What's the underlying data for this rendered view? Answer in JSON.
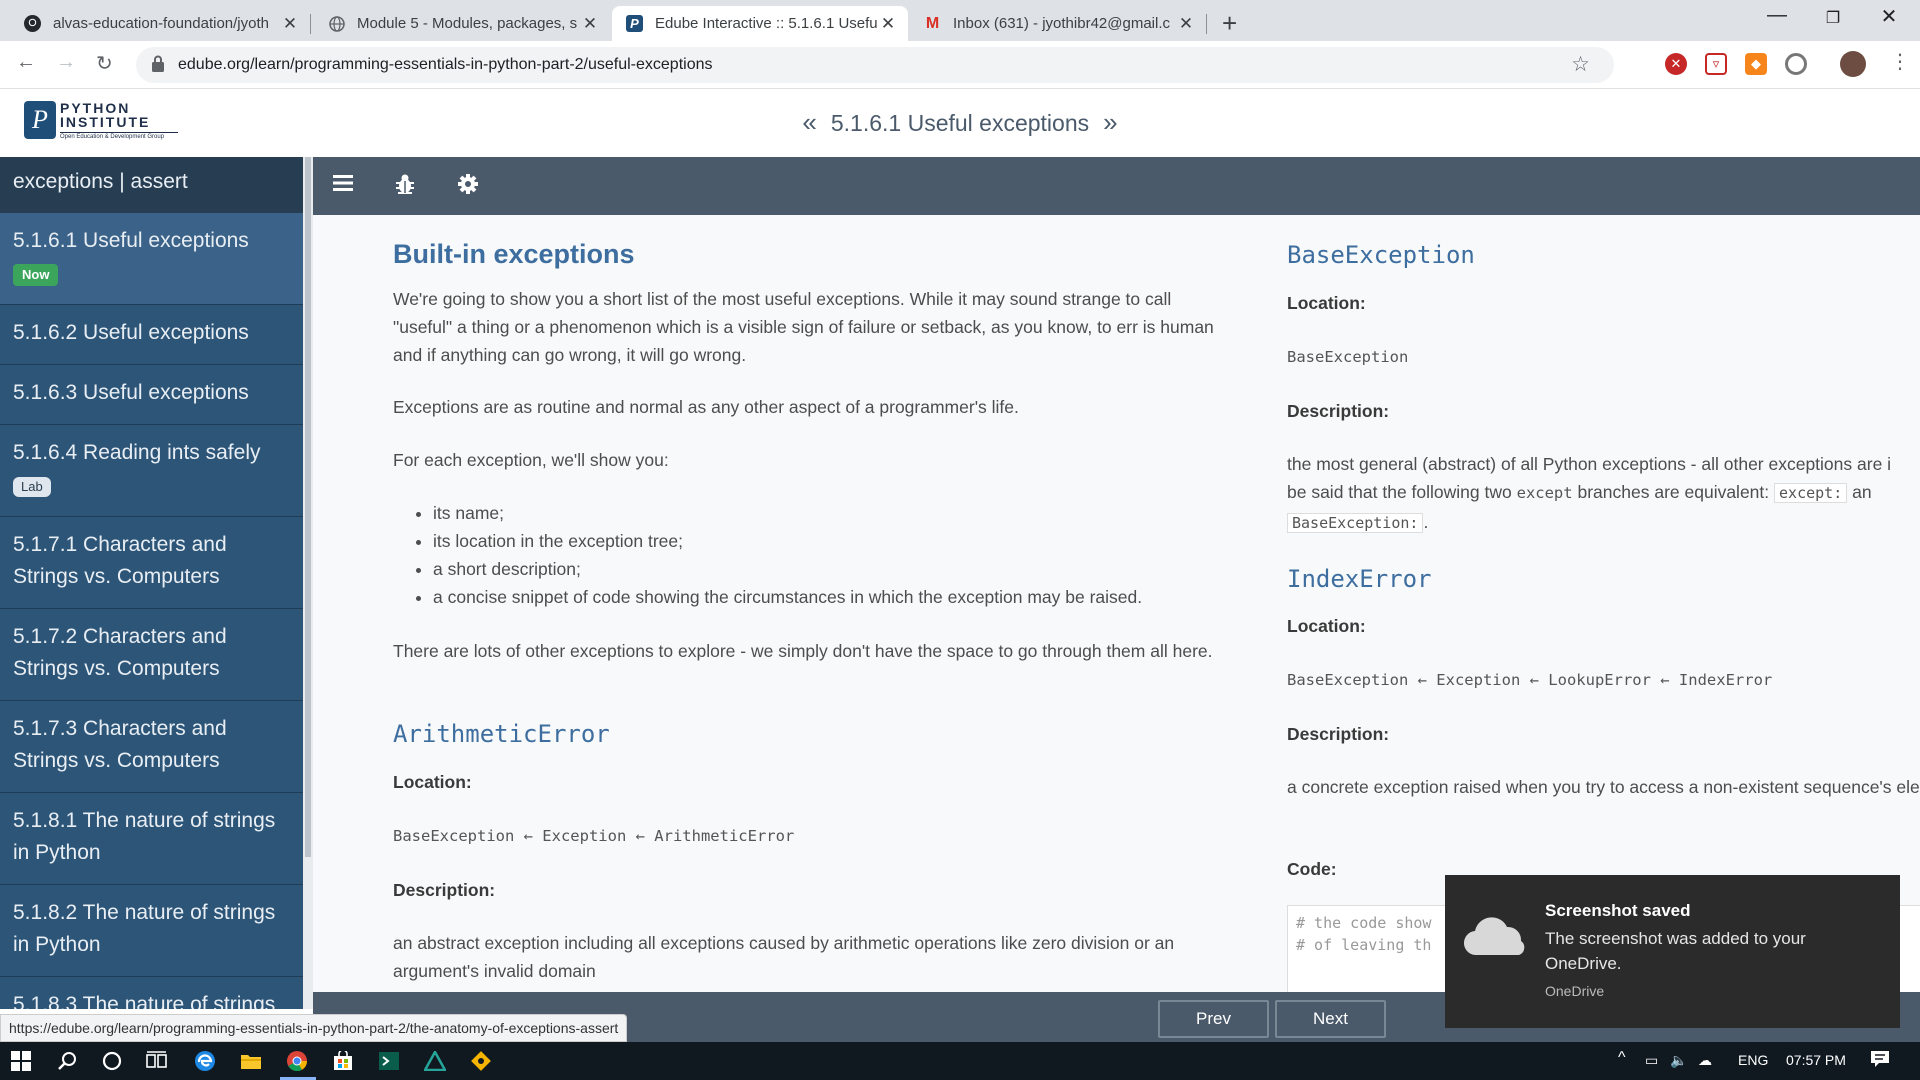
{
  "browser": {
    "tabs": [
      {
        "title": "alvas-education-foundation/jyoth",
        "icon": "github-icon"
      },
      {
        "title": "Module 5 - Modules, packages, s",
        "icon": "globe-icon"
      },
      {
        "title": "Edube Interactive :: 5.1.6.1 Useful",
        "icon": "python-institute-icon",
        "active": true
      },
      {
        "title": "Inbox (631) - jyothibr42@gmail.c",
        "icon": "gmail-icon"
      }
    ],
    "url": "edube.org/learn/programming-essentials-in-python-part-2/useful-exceptions",
    "status_url": "https://edube.org/learn/programming-essentials-in-python-part-2/the-anatomy-of-exceptions-assert"
  },
  "header": {
    "logo_line1": "PYTHON",
    "logo_line2": "INSTITUTE",
    "logo_tagline": "Open Education & Development Group",
    "logo_mark": "P",
    "page_title": "5.1.6.1 Useful exceptions",
    "prev_chevron": "«",
    "next_chevron": "»"
  },
  "sidebar": {
    "head": "exceptions | assert",
    "items": [
      {
        "label": "5.1.6.1 Useful exceptions",
        "badge": "Now",
        "current": true
      },
      {
        "label": "5.1.6.2 Useful exceptions"
      },
      {
        "label": "5.1.6.3 Useful exceptions"
      },
      {
        "label": "5.1.6.4 Reading ints safely",
        "badge": "Lab"
      },
      {
        "label": "5.1.7.1 Characters and Strings vs. Computers"
      },
      {
        "label": "5.1.7.2 Characters and Strings vs. Computers"
      },
      {
        "label": "5.1.7.3 Characters and Strings vs. Computers"
      },
      {
        "label": "5.1.8.1 The nature of strings in Python"
      },
      {
        "label": "5.1.8.2 The nature of strings in Python"
      },
      {
        "label": "5.1.8.3 The nature of strings"
      }
    ]
  },
  "content": {
    "left": {
      "heading": "Built-in exceptions",
      "p1": "We're going to show you a short list of the most useful exceptions. While it may sound strange to call \"useful\" a thing or a phenomenon which is a visible sign of failure or setback, as you know, to err is human and if anything can go wrong, it will go wrong.",
      "p2": "Exceptions are as routine and normal as any other aspect of a programmer's life.",
      "p3": "For each exception, we'll show you:",
      "bullets": [
        "its name;",
        "its location in the exception tree;",
        "a short description;",
        "a concise snippet of code showing the circumstances in which the exception may be raised."
      ],
      "p4": "There are lots of other exceptions to explore - we simply don't have the space to go through them all here.",
      "exc_name": "ArithmeticError",
      "location_label": "Location:",
      "location_value": "BaseException ← Exception ← ArithmeticError",
      "description_label": "Description:",
      "description_value": "an abstract exception including all exceptions caused by arithmetic operations like zero division or an argument's invalid domain"
    },
    "right": {
      "exc1_name": "BaseException",
      "exc1_location_label": "Location:",
      "exc1_location_value": "BaseException",
      "exc1_description_label": "Description:",
      "exc1_desc_a": "the most general (abstract) of all Python exceptions - all other exceptions are i",
      "exc1_desc_b": "be said that the following two",
      "exc1_desc_code1": "except",
      "exc1_desc_c": "branches are equivalent:",
      "exc1_desc_code2": "except:",
      "exc1_desc_d": "an",
      "exc1_desc_code3": "BaseException:",
      "exc1_desc_e": ".",
      "exc2_name": "IndexError",
      "exc2_location_label": "Location:",
      "exc2_location_value": "BaseException ← Exception ← LookupError ← IndexError",
      "exc2_description_label": "Description:",
      "exc2_description_value": "a concrete exception raised when you try to access a non-existent sequence's element)",
      "code_label": "Code:",
      "code_line1": "# the code show",
      "code_line2": "# of leaving th"
    }
  },
  "footer": {
    "prev": "Prev",
    "next": "Next"
  },
  "toast": {
    "title": "Screenshot saved",
    "body": "The screenshot was added to your OneDrive.",
    "source": "OneDrive"
  },
  "taskbar": {
    "lang": "ENG",
    "time": "07:57 PM"
  },
  "colors": {
    "sidebar": "#2d5578",
    "content_bar": "#4a5a6b",
    "heading": "#3d6e9f",
    "now_badge": "#3ba55c"
  }
}
